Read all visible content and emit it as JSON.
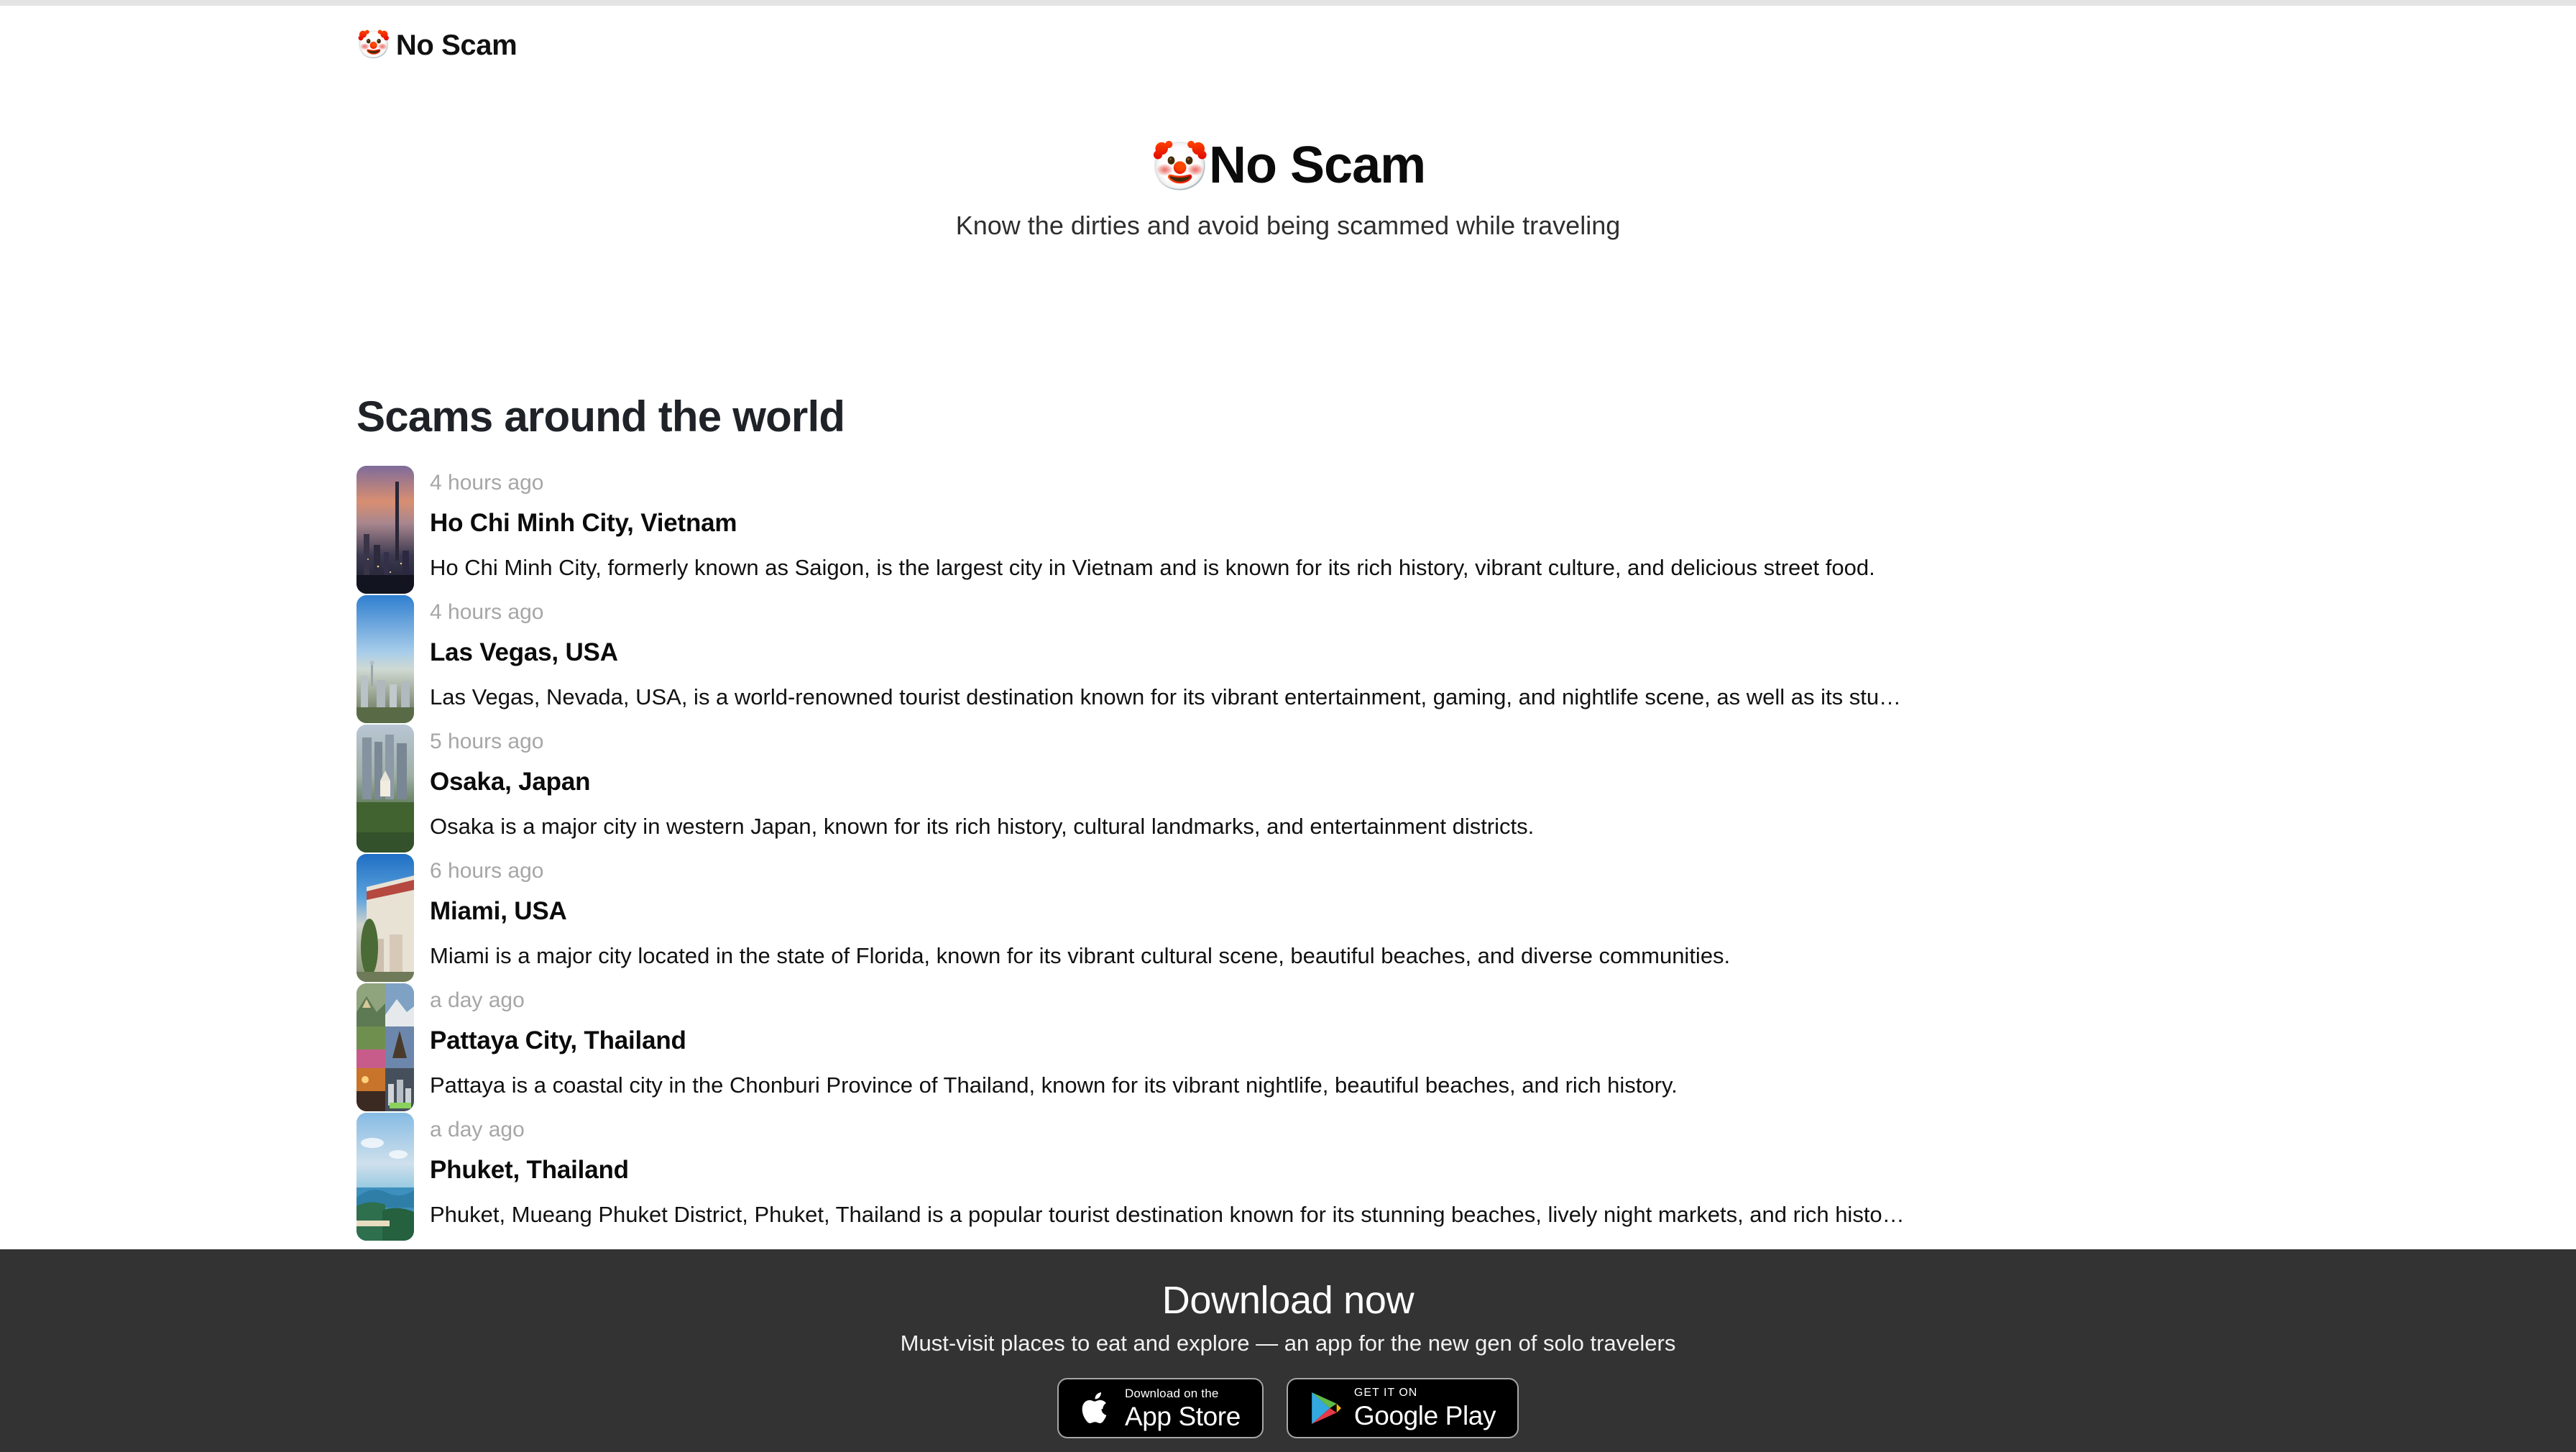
{
  "brand": {
    "emoji": "🤡",
    "name": "No Scam"
  },
  "hero": {
    "emoji": "🤡",
    "title": "No Scam",
    "subtitle": "Know the dirties and avoid being scammed while traveling"
  },
  "feed": {
    "heading": "Scams around the world",
    "items": [
      {
        "time": "4 hours ago",
        "title": "Ho Chi Minh City, Vietnam",
        "description": "Ho Chi Minh City, formerly known as Saigon, is the largest city in Vietnam and is known for its rich history, vibrant culture, and delicious street food.",
        "thumb_alt": "ho-chi-minh-city-skyline-at-sunset"
      },
      {
        "time": "4 hours ago",
        "title": "Las Vegas, USA",
        "description": "Las Vegas, Nevada, USA, is a world-renowned tourist destination known for its vibrant entertainment, gaming, and nightlife scene, as well as its stu…",
        "thumb_alt": "las-vegas-skyline-daytime"
      },
      {
        "time": "5 hours ago",
        "title": "Osaka, Japan",
        "description": "Osaka is a major city in western Japan, known for its rich history, cultural landmarks, and entertainment districts.",
        "thumb_alt": "osaka-castle-and-towers"
      },
      {
        "time": "6 hours ago",
        "title": "Miami, USA",
        "description": "Miami is a major city located in the state of Florida, known for its vibrant cultural scene, beautiful beaches, and diverse communities.",
        "thumb_alt": "miami-little-havana-building"
      },
      {
        "time": "a day ago",
        "title": "Pattaya City, Thailand",
        "description": "Pattaya is a coastal city in the Chonburi Province of Thailand, known for its vibrant nightlife, beautiful beaches, and rich history.",
        "thumb_alt": "pattaya-photo-collage"
      },
      {
        "time": "a day ago",
        "title": "Phuket, Thailand",
        "description": "Phuket, Mueang Phuket District, Phuket, Thailand is a popular tourist destination known for its stunning beaches, lively night markets, and rich histo…",
        "thumb_alt": "phuket-coastline-and-sea"
      }
    ]
  },
  "footer": {
    "title": "Download now",
    "subtitle": "Must-visit places to eat and explore — an app for the new gen of solo travelers",
    "app_store": {
      "small": "Download on the",
      "big": "App Store"
    },
    "google_play": {
      "small": "GET IT ON",
      "big": "Google Play"
    }
  },
  "colors": {
    "footer_bg": "#333333",
    "page_bg": "#ffffff",
    "muted_text": "#a6a6a6",
    "heading_text": "#1f2328"
  }
}
